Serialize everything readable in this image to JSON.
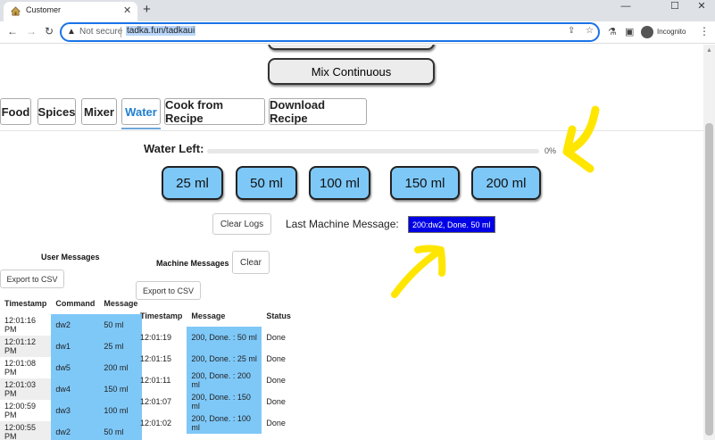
{
  "browser": {
    "tab_title": "Customer",
    "tab_close": "✕",
    "new_tab": "+",
    "win_min": "—",
    "win_max": "☐",
    "win_close": "✕",
    "back": "←",
    "forward": "→",
    "reload": "↻",
    "warning_icon": "▲",
    "not_secure": "Not secure",
    "url": "tadka.fun/tadkaui",
    "share_icon": "⇪",
    "star_icon": "☆",
    "ext_icon": "⚗",
    "panel_icon": "▣",
    "incognito_label": "Incognito",
    "menu": "⋮"
  },
  "top_buttons": {
    "mix_continuous": "Mix Continuous"
  },
  "tabs": [
    {
      "label": "Food"
    },
    {
      "label": "Spices"
    },
    {
      "label": "Mixer"
    },
    {
      "label": "Water",
      "active": true
    },
    {
      "label": "Cook from Recipe"
    },
    {
      "label": "Download Recipe"
    }
  ],
  "water": {
    "label": "Water Left:",
    "progress_percent": 0,
    "progress_text": "0%",
    "buttons": [
      "25 ml",
      "50 ml",
      "100 ml",
      "150 ml",
      "200 ml"
    ]
  },
  "logs": {
    "clear_logs": "Clear Logs",
    "last_message_label": "Last Machine Message:",
    "last_message_value": "200:dw2, Done. 50 ml"
  },
  "user_messages": {
    "title": "User Messages",
    "export": "Export to CSV",
    "columns": [
      "Timestamp",
      "Command",
      "Message"
    ],
    "rows": [
      [
        "12:01:16 PM",
        "dw2",
        "50 ml"
      ],
      [
        "12:01:12 PM",
        "dw1",
        "25 ml"
      ],
      [
        "12:01:08 PM",
        "dw5",
        "200 ml"
      ],
      [
        "12:01:03 PM",
        "dw4",
        "150 ml"
      ],
      [
        "12:00:59 PM",
        "dw3",
        "100 ml"
      ],
      [
        "12:00:55 PM",
        "dw2",
        "50 ml"
      ]
    ]
  },
  "machine_messages": {
    "title": "Machine Messages",
    "clear": "Clear",
    "export": "Export to CSV",
    "columns": [
      "Timestamp",
      "Message",
      "Status"
    ],
    "rows": [
      [
        "12:01:19",
        "200, Done. : 50 ml",
        "Done"
      ],
      [
        "12:01:15",
        "200, Done. : 25 ml",
        "Done"
      ],
      [
        "12:01:11",
        "200, Done. : 200 ml",
        "Done"
      ],
      [
        "12:01:07",
        "200, Done. : 150 ml",
        "Done"
      ],
      [
        "12:01:02",
        "200, Done. : 100 ml",
        "Done"
      ]
    ]
  },
  "colors": {
    "accent_blue": "#7ec8f8",
    "message_bg": "#0000e6",
    "annotation_yellow": "#ffe600"
  }
}
